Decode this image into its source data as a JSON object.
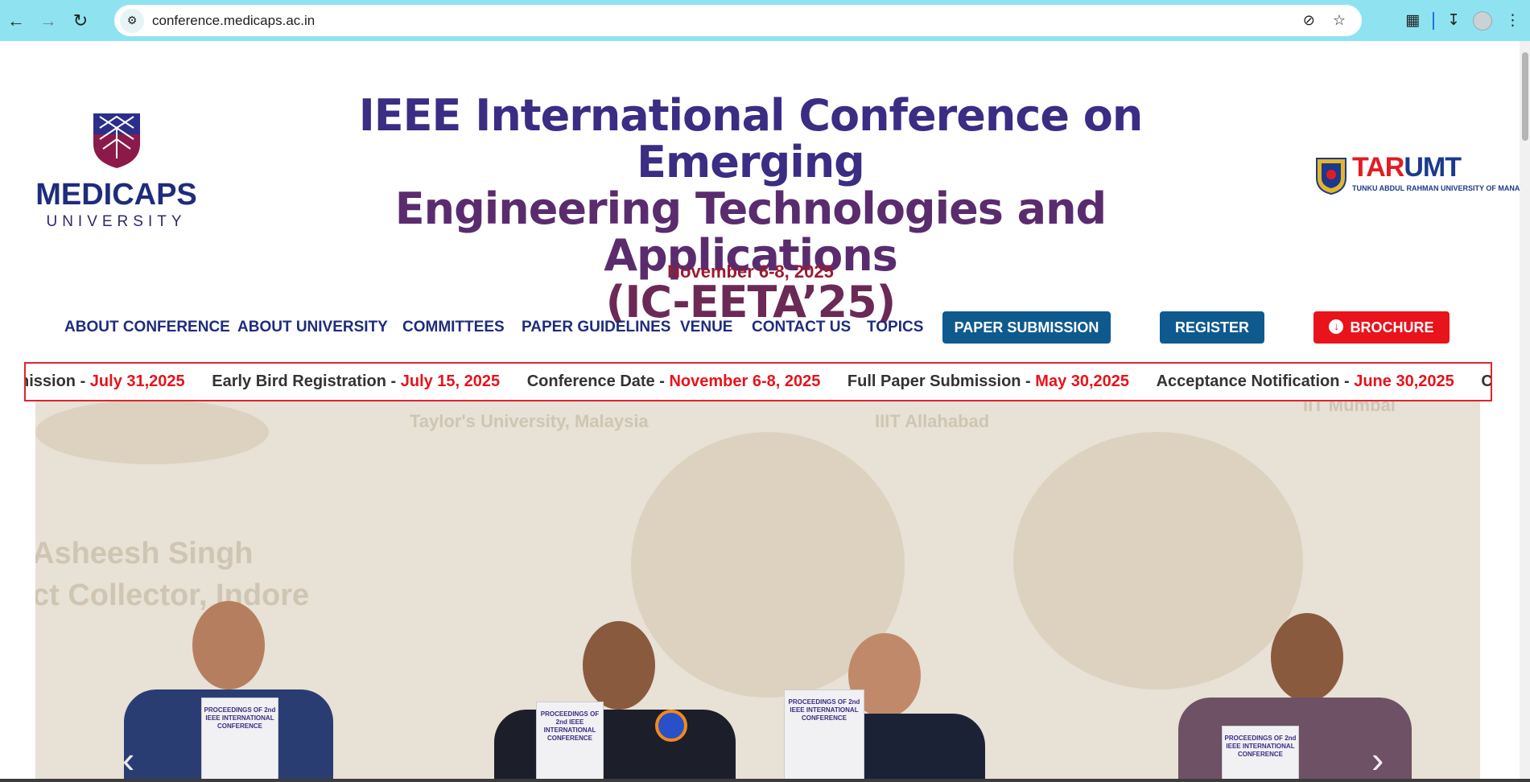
{
  "browser": {
    "url": "conference.medicaps.ac.in"
  },
  "header": {
    "medicaps_logo": {
      "name": "MEDICAPS",
      "subtitle": "UNIVERSITY"
    },
    "title_lines": [
      "IEEE International Conference on Emerging",
      "Engineering Technologies and Applications",
      "(IC-EETA’25)"
    ],
    "date": "November 6-8, 2025",
    "partner_logo": {
      "part1": "TAR",
      "part2": "UMT",
      "subtitle": "TUNKU ABDUL RAHMAN UNIVERSITY OF MANAGEMENT AND TECHNOLOGY"
    }
  },
  "nav": {
    "links": [
      "ABOUT CONFERENCE",
      "ABOUT UNIVERSITY",
      "COMMITTEES",
      "PAPER GUIDELINES",
      "VENUE",
      "CONTACT US",
      "TOPICS"
    ],
    "paper_submission": "PAPER SUBMISSION",
    "register": "REGISTER",
    "brochure": "BROCHURE"
  },
  "ticker": {
    "items": [
      {
        "label": "nission - ",
        "date": "July 31,2025"
      },
      {
        "label": "Early Bird Registration - ",
        "date": "July 15, 2025"
      },
      {
        "label": "Conference Date - ",
        "date": "November 6-8, 2025"
      },
      {
        "label": "Full Paper Submission - ",
        "date": "May 30,2025"
      },
      {
        "label": "Acceptance Notification - ",
        "date": "June 30,2025"
      },
      {
        "label": "Camera Read",
        "date": ""
      }
    ]
  },
  "hero": {
    "booklet_text": "PROCEEDINGS OF 2nd IEEE INTERNATIONAL CONFERENCE",
    "background_texts": [
      "Taylor's University, Malaysia",
      "IIIT Allahabad",
      "Asheesh Singh",
      "ct Collector, Indore",
      "IIT Mumbai"
    ]
  },
  "colors": {
    "browser_bar": "#8fe3f1",
    "nav_text": "#1f2c7d",
    "pill_blue": "#0e5a8f",
    "pill_red": "#e8131b",
    "ticker_border": "#e0232f",
    "date_color": "#9b1b30"
  }
}
